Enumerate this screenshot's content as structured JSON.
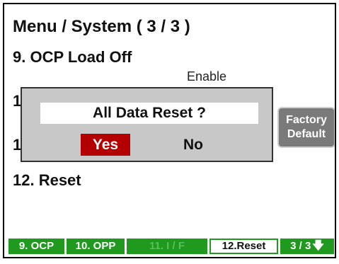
{
  "header": {
    "title": "Menu / System ( 3 / 3 )"
  },
  "items": {
    "item9": {
      "label": "9. OCP Load Off",
      "value": "Enable"
    },
    "item10": {
      "label": "1"
    },
    "item11": {
      "label": "1"
    },
    "item12": {
      "label": "12. Reset"
    }
  },
  "dialog": {
    "message": "All Data Reset ?",
    "yes_label": "Yes",
    "no_label": "No"
  },
  "side_button": {
    "line1": "Factory",
    "line2": "Default"
  },
  "softkeys": [
    {
      "label": "9. OCP",
      "state": "normal"
    },
    {
      "label": "10. OPP",
      "state": "normal"
    },
    {
      "label": "11. I / F",
      "state": "disabled"
    },
    {
      "label": "12.Reset",
      "state": "active"
    },
    {
      "label": "3 / 3",
      "icon": "arrow-down-icon",
      "state": "normal"
    }
  ],
  "colors": {
    "softkey_green": "#1f9a1f",
    "yes_red": "#b30000",
    "dialog_gray": "#c8c8c8",
    "side_button_gray": "#7a7a7a"
  }
}
